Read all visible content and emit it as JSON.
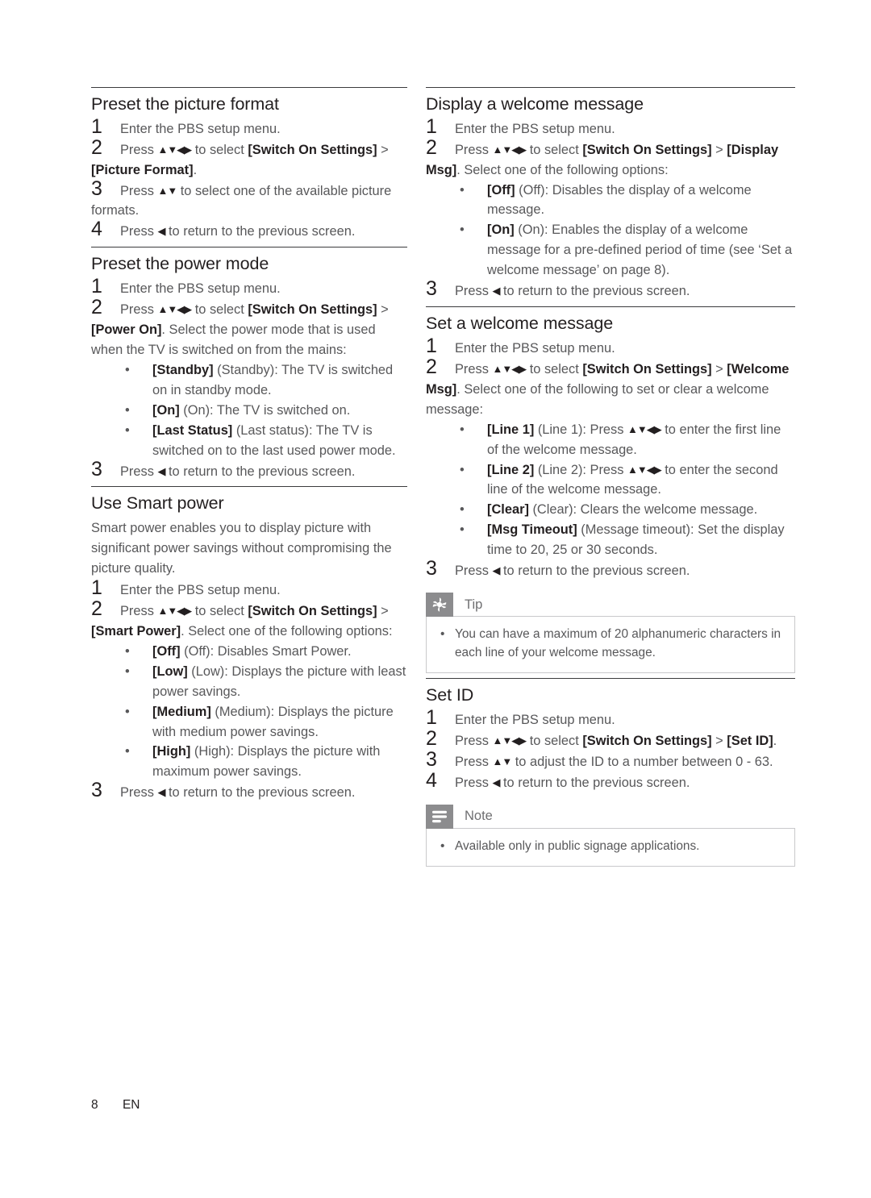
{
  "page": {
    "footer_page_number": "8",
    "footer_language": "EN",
    "text_color": "#58585a",
    "term_color": "#231f20",
    "rule_color": "#3b3b3d",
    "badge_color": "#8c8c8e",
    "box_border_color": "#c9c9cb"
  },
  "arrows": {
    "four_way": "▲▼◀▶",
    "up_down": "▲▼",
    "left": "◀",
    "bullet": "•"
  },
  "left_column": {
    "sections": [
      {
        "heading": "Preset the picture format",
        "steps": [
          {
            "num": "1",
            "parts": [
              {
                "t": "Enter the PBS setup menu."
              }
            ]
          },
          {
            "num": "2",
            "parts": [
              {
                "t": "Press "
              },
              {
                "a": "four_way"
              },
              {
                "t": " to select "
              },
              {
                "b": "[Switch On Settings]"
              },
              {
                "t": " > "
              },
              {
                "b": "[Picture Format]"
              },
              {
                "t": "."
              }
            ]
          },
          {
            "num": "3",
            "parts": [
              {
                "t": "Press "
              },
              {
                "a": "up_down"
              },
              {
                "t": " to select one of the available picture formats."
              }
            ]
          },
          {
            "num": "4",
            "parts": [
              {
                "t": "Press "
              },
              {
                "a": "left"
              },
              {
                "t": " to return to the previous screen."
              }
            ]
          }
        ]
      },
      {
        "heading": "Preset the power mode",
        "steps": [
          {
            "num": "1",
            "parts": [
              {
                "t": "Enter the PBS setup menu."
              }
            ]
          },
          {
            "num": "2",
            "parts": [
              {
                "t": "Press "
              },
              {
                "a": "four_way"
              },
              {
                "t": " to select "
              },
              {
                "b": "[Switch On Settings]"
              },
              {
                "t": " > "
              },
              {
                "b": "[Power On]"
              },
              {
                "t": ". Select the power mode that is used when the TV is switched on from the mains:"
              }
            ],
            "bullets": [
              {
                "parts": [
                  {
                    "b": "[Standby]"
                  },
                  {
                    "t": " (Standby): The TV is switched on in standby mode."
                  }
                ]
              },
              {
                "parts": [
                  {
                    "b": "[On]"
                  },
                  {
                    "t": " (On): The TV is switched on."
                  }
                ]
              },
              {
                "parts": [
                  {
                    "b": "[Last Status]"
                  },
                  {
                    "t": " (Last status): The TV is switched on to the last used power mode."
                  }
                ]
              }
            ]
          },
          {
            "num": "3",
            "parts": [
              {
                "t": "Press "
              },
              {
                "a": "left"
              },
              {
                "t": " to return to the previous screen."
              }
            ]
          }
        ]
      },
      {
        "heading": "Use Smart power",
        "intro": "Smart power enables you to display picture with significant power savings without compromising the picture quality.",
        "steps": [
          {
            "num": "1",
            "parts": [
              {
                "t": "Enter the PBS setup menu."
              }
            ]
          },
          {
            "num": "2",
            "parts": [
              {
                "t": "Press "
              },
              {
                "a": "four_way"
              },
              {
                "t": " to select "
              },
              {
                "b": "[Switch On Settings]"
              },
              {
                "t": " > "
              },
              {
                "b": "[Smart Power]"
              },
              {
                "t": ". Select one of the following options:"
              }
            ],
            "bullets": [
              {
                "parts": [
                  {
                    "b": "[Off]"
                  },
                  {
                    "t": " (Off): Disables Smart Power."
                  }
                ]
              },
              {
                "parts": [
                  {
                    "b": "[Low]"
                  },
                  {
                    "t": " (Low): Displays the picture with least power savings."
                  }
                ]
              },
              {
                "parts": [
                  {
                    "b": "[Medium]"
                  },
                  {
                    "t": " (Medium): Displays the picture with medium power savings."
                  }
                ]
              },
              {
                "parts": [
                  {
                    "b": "[High]"
                  },
                  {
                    "t": " (High): Displays the picture with maximum power savings."
                  }
                ]
              }
            ]
          },
          {
            "num": "3",
            "parts": [
              {
                "t": "Press "
              },
              {
                "a": "left"
              },
              {
                "t": " to return to the previous screen."
              }
            ]
          }
        ]
      }
    ]
  },
  "right_column": {
    "sections": [
      {
        "heading": "Display a welcome message",
        "steps": [
          {
            "num": "1",
            "parts": [
              {
                "t": "Enter the PBS setup menu."
              }
            ]
          },
          {
            "num": "2",
            "parts": [
              {
                "t": "Press "
              },
              {
                "a": "four_way"
              },
              {
                "t": " to select "
              },
              {
                "b": "[Switch On Settings]"
              },
              {
                "t": " > "
              },
              {
                "b": "[Display Msg]"
              },
              {
                "t": ". Select one of the following options:"
              }
            ],
            "bullets": [
              {
                "parts": [
                  {
                    "b": "[Off]"
                  },
                  {
                    "t": " (Off): Disables the display of a welcome message."
                  }
                ]
              },
              {
                "parts": [
                  {
                    "b": "[On]"
                  },
                  {
                    "t": " (On): Enables the display of a welcome message for a pre-defined period of time (see ‘Set a welcome message’ on page 8)."
                  }
                ]
              }
            ]
          },
          {
            "num": "3",
            "parts": [
              {
                "t": "Press "
              },
              {
                "a": "left"
              },
              {
                "t": " to return to the previous screen."
              }
            ]
          }
        ]
      },
      {
        "heading": "Set a welcome message",
        "steps": [
          {
            "num": "1",
            "parts": [
              {
                "t": "Enter the PBS setup menu."
              }
            ]
          },
          {
            "num": "2",
            "parts": [
              {
                "t": "Press "
              },
              {
                "a": "four_way"
              },
              {
                "t": " to select "
              },
              {
                "b": "[Switch On Settings]"
              },
              {
                "t": " > "
              },
              {
                "b": "[Welcome Msg]"
              },
              {
                "t": ". Select one of the following to set or clear a welcome message:"
              }
            ],
            "bullets": [
              {
                "parts": [
                  {
                    "b": "[Line 1]"
                  },
                  {
                    "t": " (Line 1): Press "
                  },
                  {
                    "a": "four_way"
                  },
                  {
                    "t": " to enter the first line of the welcome message."
                  }
                ]
              },
              {
                "parts": [
                  {
                    "b": "[Line 2]"
                  },
                  {
                    "t": " (Line 2): Press "
                  },
                  {
                    "a": "four_way"
                  },
                  {
                    "t": " to enter the second line of the welcome message."
                  }
                ]
              },
              {
                "parts": [
                  {
                    "b": "[Clear]"
                  },
                  {
                    "t": " (Clear): Clears the welcome message."
                  }
                ]
              },
              {
                "parts": [
                  {
                    "b": "[Msg Timeout]"
                  },
                  {
                    "t": " (Message timeout): Set the display time to 20, 25 or 30 seconds."
                  }
                ]
              }
            ]
          },
          {
            "num": "3",
            "parts": [
              {
                "t": "Press "
              },
              {
                "a": "left"
              },
              {
                "t": " to return to the previous screen."
              }
            ]
          }
        ],
        "callout": {
          "kind": "tip",
          "icon": "asterisk-flower-icon",
          "title": "Tip",
          "items": [
            "You can have a maximum of 20 alphanumeric characters in each line of your welcome message."
          ]
        }
      },
      {
        "heading": "Set ID",
        "steps": [
          {
            "num": "1",
            "parts": [
              {
                "t": "Enter the PBS setup menu."
              }
            ]
          },
          {
            "num": "2",
            "parts": [
              {
                "t": "Press "
              },
              {
                "a": "four_way"
              },
              {
                "t": " to select "
              },
              {
                "b": "[Switch On Settings]"
              },
              {
                "t": " > "
              },
              {
                "b": "[Set ID]"
              },
              {
                "t": "."
              }
            ]
          },
          {
            "num": "3",
            "parts": [
              {
                "t": "Press "
              },
              {
                "a": "up_down"
              },
              {
                "t": " to adjust the ID to a number between 0 - 63."
              }
            ]
          },
          {
            "num": "4",
            "parts": [
              {
                "t": "Press "
              },
              {
                "a": "left"
              },
              {
                "t": " to return to the previous screen."
              }
            ]
          }
        ],
        "callout": {
          "kind": "note",
          "icon": "lines-note-icon",
          "title": "Note",
          "items": [
            "Available only in public signage applications."
          ]
        }
      }
    ]
  }
}
